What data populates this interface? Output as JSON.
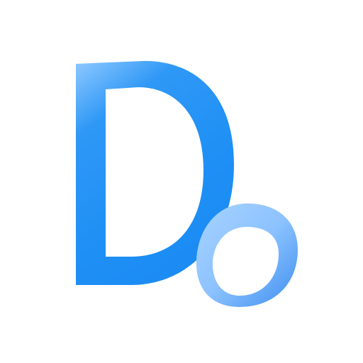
{
  "logo": {
    "name": "Do",
    "big_letter": "D",
    "small_letter": "o",
    "colors": {
      "primary": "#1e8ff5",
      "primary_highlight": "#8cc8ff",
      "secondary": "#8ec4ff",
      "secondary_deep": "#3f8ff0",
      "background": "#ffffff"
    }
  }
}
